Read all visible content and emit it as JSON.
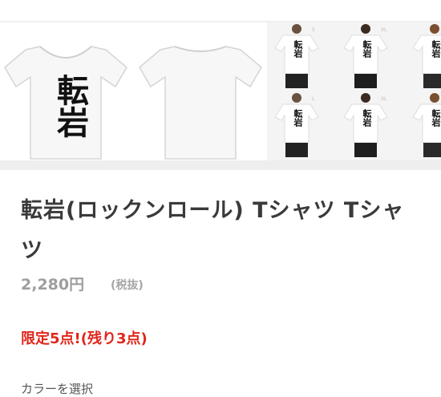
{
  "gallery": {
    "front_print": "転岩",
    "model_prints": [
      "転岩",
      "転岩",
      "転岩",
      "転岩",
      "転岩",
      "転岩"
    ],
    "size_tags": [
      "S",
      "M",
      "L",
      "XL"
    ]
  },
  "product": {
    "title": "転岩(ロックンロール) Tシャツ Tシャツ",
    "price": "2,280円",
    "tax_note": "(税抜)",
    "limited": "限定5点!(残り3点)"
  },
  "options": {
    "color_label": "カラーを選択"
  }
}
